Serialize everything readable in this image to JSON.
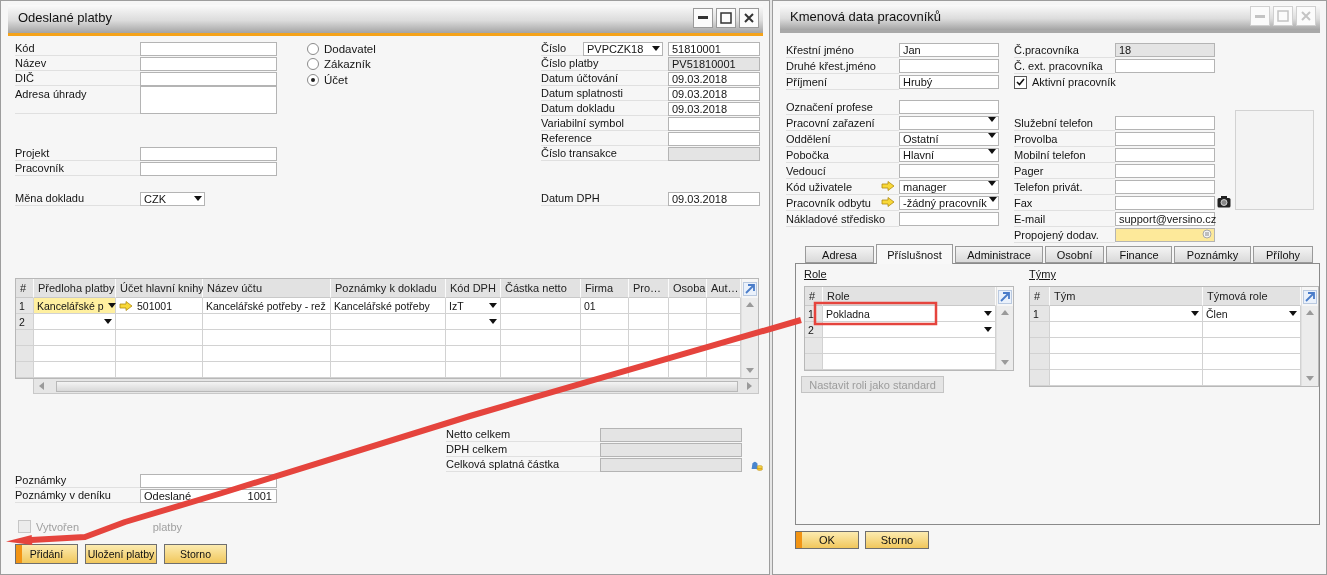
{
  "payment": {
    "title": "Odeslané platby",
    "controls_disabled": false,
    "party_fields": [
      {
        "label": "Kód",
        "kind": "input"
      },
      {
        "label": "Název",
        "kind": "input"
      },
      {
        "label": "DIČ",
        "kind": "input"
      },
      {
        "label": "Adresa úhrady",
        "kind": "textarea"
      }
    ],
    "project_fields": [
      {
        "label": "Projekt",
        "kind": "input"
      },
      {
        "label": "Pracovník",
        "kind": "input"
      }
    ],
    "currency": {
      "label": "Měna dokladu",
      "value": "CZK"
    },
    "party_type": [
      {
        "label": "Dodavatel",
        "selected": false
      },
      {
        "label": "Zákazník",
        "selected": false
      },
      {
        "label": "Účet",
        "selected": true
      }
    ],
    "number": {
      "label": "Číslo",
      "series": "PVPCZK18",
      "value": "51810001"
    },
    "doc_fields": [
      {
        "label": "Číslo platby",
        "kind": "readonly",
        "value": "PV51810001"
      },
      {
        "label": "Datum účtování",
        "kind": "input",
        "value": "09.03.2018"
      },
      {
        "label": "Datum splatnosti",
        "kind": "input",
        "value": "09.03.2018"
      },
      {
        "label": "Datum dokladu",
        "kind": "input",
        "value": "09.03.2018"
      },
      {
        "label": "Variabilní symbol",
        "kind": "input"
      },
      {
        "label": "Reference",
        "kind": "input"
      },
      {
        "label": "Číslo transakce",
        "kind": "readonly"
      }
    ],
    "vat_date": {
      "label": "Datum DPH",
      "value": "09.03.2018"
    },
    "table": {
      "columns": [
        "#",
        "Předloha platby",
        "Účet hlavní knihy",
        "Název účtu",
        "Poznámky k dokladu",
        "Kód DPH",
        "Částka netto",
        "Firma",
        "Pro…",
        "Osoba",
        "Aut…"
      ],
      "rows": [
        {
          "number": "1",
          "template": "Kancelářské p",
          "account": "501001",
          "account_name": "Kancelářské potřeby - rež",
          "remarks": "Kancelářské potřeby",
          "vat_code": "IzT",
          "company": "01",
          "focused": true
        },
        {
          "number": "2",
          "focused": false
        }
      ]
    },
    "totals": [
      {
        "label": "Netto celkem"
      },
      {
        "label": "DPH celkem"
      },
      {
        "label": "Celková splatná částka"
      }
    ],
    "remarks": [
      {
        "label": "Poznámky"
      },
      {
        "label": "Poznámky v deníku",
        "value_parts": [
          "Odeslané",
          "1001"
        ]
      }
    ],
    "assistant": {
      "label_parts": [
        "Vytvořen",
        "platby"
      ],
      "checked": false,
      "disabled": true
    },
    "buttons": [
      {
        "label": "Přidání",
        "primary": true
      },
      {
        "label": "Uložení platby",
        "primary": false
      },
      {
        "label": "Storno",
        "primary": false
      }
    ]
  },
  "employee": {
    "title": "Kmenová data pracovníků",
    "controls_disabled": true,
    "name_fields": [
      {
        "label": "Křestní jméno",
        "kind": "input",
        "value": "Jan"
      },
      {
        "label": "Druhé křest.jméno",
        "kind": "input"
      },
      {
        "label": "Příjmení",
        "kind": "input",
        "value": "Hrubý"
      }
    ],
    "id_fields": [
      {
        "label": "Č.pracovníka",
        "kind": "readonly",
        "value": "18"
      },
      {
        "label": "Č. ext. pracovníka",
        "kind": "input"
      }
    ],
    "active": {
      "label": "Aktivní pracovník",
      "checked": true
    },
    "org_fields": [
      {
        "label": "Označení profese",
        "kind": "input",
        "link": false
      },
      {
        "label": "Pracovní zařazení",
        "kind": "dropdown",
        "link": false
      },
      {
        "label": "Oddělení",
        "kind": "dropdown",
        "value": "Ostatní",
        "link": false
      },
      {
        "label": "Pobočka",
        "kind": "dropdown",
        "value": "Hlavní",
        "link": false
      },
      {
        "label": "Vedoucí",
        "kind": "input",
        "link": false
      },
      {
        "label": "Kód uživatele",
        "kind": "dropdown",
        "value": "manager",
        "link": true
      },
      {
        "label": "Pracovník odbytu",
        "kind": "dropdown",
        "value": "-žádný pracovník",
        "link": true
      },
      {
        "label": "Nákladové středisko",
        "kind": "input",
        "link": false
      }
    ],
    "contact_fields": [
      {
        "label": "Služební telefon",
        "kind": "input"
      },
      {
        "label": "Provolba",
        "kind": "input"
      },
      {
        "label": "Mobilní telefon",
        "kind": "input"
      },
      {
        "label": "Pager",
        "kind": "input"
      },
      {
        "label": "Telefon privát.",
        "kind": "input"
      },
      {
        "label": "Fax",
        "kind": "input"
      },
      {
        "label": "E-mail",
        "kind": "input",
        "value": "support@versino.cz"
      },
      {
        "label": "Propojený dodav.",
        "kind": "linked"
      }
    ],
    "tabs": [
      {
        "label": "Adresa",
        "selected": false
      },
      {
        "label": "Příslušnost",
        "selected": true
      },
      {
        "label": "Administrace",
        "selected": false
      },
      {
        "label": "Osobní",
        "selected": false
      },
      {
        "label": "Finance",
        "selected": false
      },
      {
        "label": "Poznámky",
        "selected": false
      },
      {
        "label": "Přílohy",
        "selected": false
      }
    ],
    "roles": {
      "title": "Role",
      "columns": [
        "#",
        "Role"
      ],
      "rows": [
        {
          "number": "1",
          "role": "Pokladna"
        },
        {
          "number": "2"
        }
      ]
    },
    "teams": {
      "title": "Týmy",
      "columns": [
        "#",
        "Tým",
        "Týmová role"
      ],
      "rows": [
        {
          "number": "1",
          "role": "Člen"
        }
      ]
    },
    "set_default_button": {
      "label": "Nastavit roli jako standard",
      "disabled": true
    },
    "buttons": [
      {
        "label": "OK",
        "primary": true
      },
      {
        "label": "Storno",
        "primary": false
      }
    ]
  }
}
